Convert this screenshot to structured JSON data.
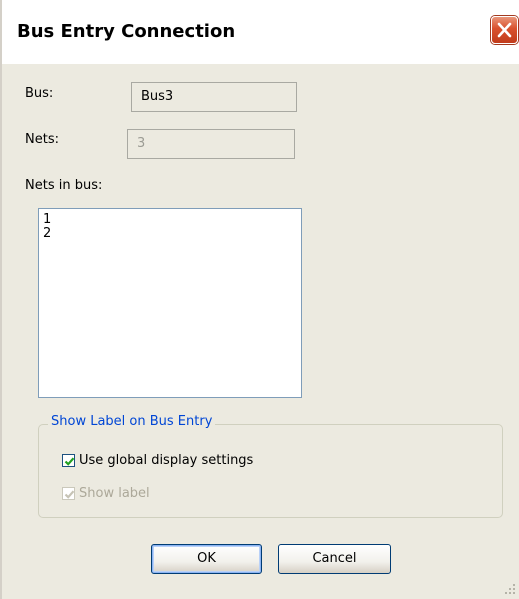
{
  "window": {
    "title": "Bus Entry Connection"
  },
  "form": {
    "bus_label": "Bus:",
    "bus_value": "Bus3",
    "nets_label": "Nets:",
    "nets_value": "3",
    "nets_in_bus_label": "Nets in bus:",
    "nets_in_bus": [
      "1",
      "2"
    ]
  },
  "group": {
    "legend": "Show Label on Bus Entry",
    "use_global_label": "Use global display settings",
    "use_global_checked": true,
    "show_label_label": "Show label",
    "show_label_checked": true,
    "show_label_enabled": false
  },
  "buttons": {
    "ok_label": "OK",
    "cancel_label": "Cancel"
  },
  "colors": {
    "group_legend": "#0046d5",
    "checkmark": "#21a121",
    "close_button": "#d9512d"
  },
  "icons": {
    "close": "close-x-icon",
    "checkmark": "checkmark-icon",
    "resize_grip": "resize-grip-icon"
  }
}
